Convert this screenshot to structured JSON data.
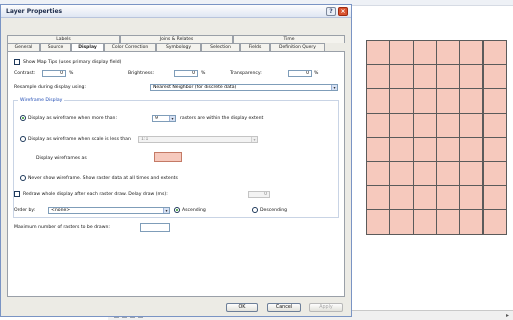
{
  "dialog": {
    "title": "Layer Properties",
    "help_glyph": "?",
    "close_glyph": "×"
  },
  "tabs_back": [
    "Labels",
    "Joins & Relates",
    "Time"
  ],
  "tabs_front": [
    "General",
    "Source",
    "Display",
    "Color Correction",
    "Symbology",
    "Selection",
    "Fields",
    "Definition Query"
  ],
  "active_tab": "Display",
  "display": {
    "map_tips_label": "Show Map Tips (uses primary display field)",
    "contrast_label": "Contrast:",
    "contrast_value": "0",
    "brightness_label": "Brightness:",
    "brightness_value": "0",
    "transparency_label": "Transparency:",
    "transparency_value": "0",
    "percent": "%",
    "resample_label": "Resample during display using:",
    "resample_value": "Nearest Neighbor (for discrete data)"
  },
  "wireframe": {
    "group_title": "Wireframe Display",
    "opt1_label": "Display as wireframe when more than:",
    "opt1_value": "9",
    "opt1_suffix": "rasters are within the display extent",
    "opt2_label": "Display as wireframe when scale is less than",
    "opt2_value": "1:1",
    "wireframe_as_label": "Display wireframes as",
    "opt3_label": "Never show wireframe. Show raster data at all times and extents"
  },
  "redraw": {
    "label": "Redraw whole display after each raster draw. Delay draw (ms):",
    "value": "0"
  },
  "order": {
    "label": "Order by:",
    "value": "<none>",
    "ascending": "Ascending",
    "descending": "Descending"
  },
  "max_rasters": {
    "label": "Maximum number of rasters to be drawn:",
    "value": ""
  },
  "buttons": {
    "ok": "OK",
    "cancel": "Cancel",
    "apply": "Apply"
  },
  "colors": {
    "raster_fill": "#f6c9bd",
    "dialog_bg": "#ecebe5",
    "accent": "#1f4bb4"
  },
  "map": {
    "columns": 6,
    "rows": 8
  }
}
